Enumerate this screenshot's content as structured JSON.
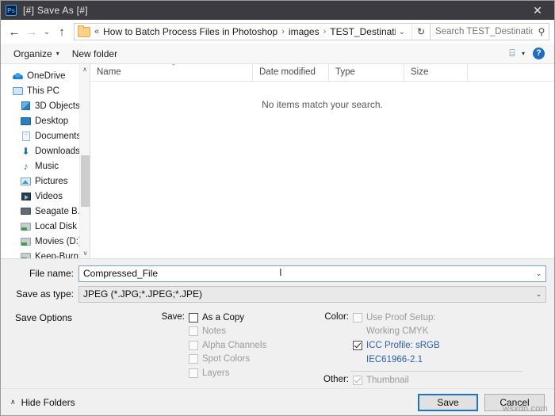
{
  "titlebar": {
    "app_icon": "photoshop-icon",
    "icon_text": "Ps",
    "title": "[#] Save As [#]",
    "close_label": "✕"
  },
  "navbar": {
    "back_icon": "←",
    "forward_icon": "→",
    "recent_icon": "⌄",
    "up_icon": "↑",
    "overflow": "«",
    "breadcrumbs": [
      "How to Batch Process Files in Photoshop",
      "images",
      "TEST_Destination"
    ],
    "separator": "›",
    "dropdown_icon": "⌄",
    "refresh_icon": "↻",
    "search_placeholder": "Search TEST_Destination",
    "search_value": "",
    "search_icon": "⚲"
  },
  "commandbar": {
    "organize_label": "Organize",
    "organize_caret": "▾",
    "new_folder_label": "New folder",
    "view_icon": "⌸",
    "view_caret": "▾",
    "help_label": "?"
  },
  "sidebar": {
    "items": [
      {
        "label": "OneDrive",
        "icon": "cloud-icon",
        "indent": 0
      },
      {
        "label": "This PC",
        "icon": "monitor-icon",
        "indent": 0
      },
      {
        "label": "3D Objects",
        "icon": "box-icon",
        "indent": 1
      },
      {
        "label": "Desktop",
        "icon": "desktop-icon",
        "indent": 1
      },
      {
        "label": "Documents",
        "icon": "document-icon",
        "indent": 1
      },
      {
        "label": "Downloads",
        "icon": "download-icon",
        "indent": 1
      },
      {
        "label": "Music",
        "icon": "music-icon",
        "indent": 1
      },
      {
        "label": "Pictures",
        "icon": "pictures-icon",
        "indent": 1
      },
      {
        "label": "Videos",
        "icon": "video-icon",
        "indent": 1
      },
      {
        "label": "Seagate Backup",
        "icon": "external-drive-icon",
        "indent": 1
      },
      {
        "label": "Local Disk (C:)",
        "icon": "drive-icon",
        "indent": 1
      },
      {
        "label": "Movies (D:)",
        "icon": "drive-icon",
        "indent": 1
      },
      {
        "label": "Keep-Burn (F:)",
        "icon": "drive-icon",
        "indent": 1
      }
    ],
    "scroll_up_icon": "∧",
    "scroll_down_icon": "∨"
  },
  "filelist": {
    "columns": [
      "Name",
      "Date modified",
      "Type",
      "Size"
    ],
    "sort_caret": "⌃",
    "empty_message": "No items match your search.",
    "rows": []
  },
  "form": {
    "filename_label": "File name:",
    "filename_value": "Compressed_File",
    "filetype_label": "Save as type:",
    "filetype_value": "JPEG (*.JPG;*.JPEG;*.JPE)",
    "dropdown_icon": "⌄",
    "text_cursor": "I"
  },
  "save_options": {
    "heading": "Save Options",
    "save_group_label": "Save:",
    "save_items": [
      {
        "label": "As a Copy",
        "checked": false,
        "disabled": false
      },
      {
        "label": "Notes",
        "checked": false,
        "disabled": true
      },
      {
        "label": "Alpha Channels",
        "checked": false,
        "disabled": true
      },
      {
        "label": "Spot Colors",
        "checked": false,
        "disabled": true
      },
      {
        "label": "Layers",
        "checked": false,
        "disabled": true
      }
    ],
    "color_group_label": "Color:",
    "proof_setup_label": "Use Proof Setup:",
    "proof_setup_value": "Working CMYK",
    "proof_setup_checked": false,
    "proof_setup_disabled": true,
    "icc_label": "ICC Profile:  sRGB",
    "icc_value": "IEC61966-2.1",
    "icc_checked": true,
    "other_group_label": "Other:",
    "thumbnail_label": "Thumbnail",
    "thumbnail_checked": true,
    "thumbnail_disabled": true,
    "link_color": "#2a5db0"
  },
  "footer": {
    "hide_folders_label": "Hide Folders",
    "hide_folders_caret": "∧",
    "save_label": "Save",
    "cancel_label": "Cancel",
    "accent_color": "#1d74c4"
  },
  "watermark": {
    "text": "wsxdn.com"
  }
}
